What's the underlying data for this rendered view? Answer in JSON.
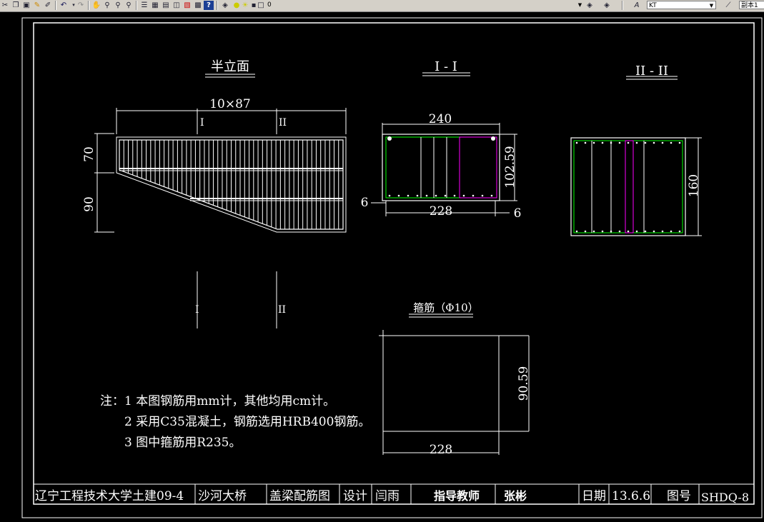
{
  "toolbar": {
    "icons": [
      "scissors-icon",
      "copy-icon",
      "paste-icon",
      "brush-icon",
      "match-prop-icon",
      "undo-icon",
      "redo-icon",
      "pan-icon",
      "zoom-realtime-icon",
      "zoom-window-icon",
      "zoom-previous-icon",
      "properties-icon",
      "design-center-icon",
      "tool-palette-icon",
      "sheet-set-icon",
      "markup-icon",
      "calculator-icon",
      "help-icon",
      "layer-manager-icon",
      "layer-state-icons"
    ],
    "layer_value": "0",
    "text_style_value": "KT",
    "dim_style_partial": "副本1"
  },
  "drawing": {
    "titles": {
      "half_elevation": "半立面",
      "section_1": "I - I",
      "section_2": "II - II",
      "stirrup": "箍筋（Φ10）"
    },
    "elevation": {
      "top_dim": "10×87",
      "dim_70": "70",
      "dim_90": "90",
      "mark_1": "I",
      "mark_2": "II",
      "cut_1": "I",
      "cut_2": "II"
    },
    "section1": {
      "dim_240": "240",
      "dim_102": "102.59",
      "dim_228": "228",
      "dim_6_left": "6",
      "dim_6_right": "6"
    },
    "section2": {
      "dim_160": "160"
    },
    "stirrup": {
      "dim_height": "90.59",
      "dim_width": "228"
    },
    "notes": [
      "注：1 本图钢筋用mm计，其他均用cm计。",
      "2 采用C35混凝土，钢筋选用HRB400钢筋。",
      "3 图中箍筋用R235。"
    ],
    "title_block": {
      "school": "辽宁工程技术大学土建09-4",
      "project": "沙河大桥",
      "drawing_name": "盖梁配筋图",
      "design_label": "设计",
      "designer": "闫雨",
      "advisor_label": "指导教师",
      "advisor": "张彬",
      "date_label": "日期",
      "date": "13.6.6",
      "drawing_no_label": "图号",
      "drawing_no": "SHDQ-8"
    }
  },
  "colors": {
    "background": "#000000",
    "lines": "#ffffff",
    "green_rebar": "#00ff00",
    "magenta_rebar": "#ff00ff",
    "toolbar": "#d4d0c8"
  }
}
